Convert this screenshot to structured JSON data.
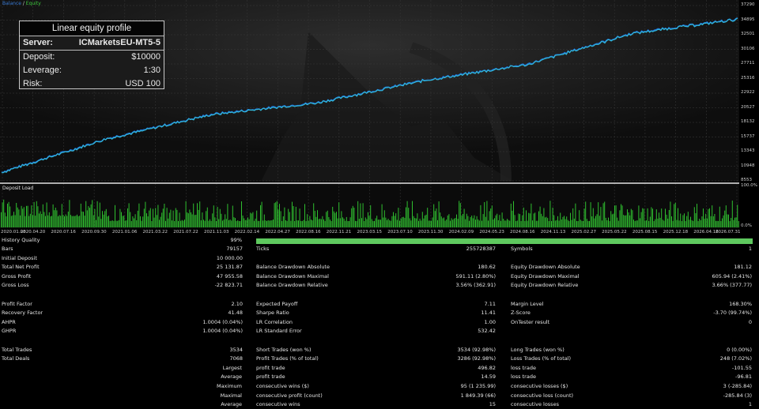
{
  "legend": {
    "balance": "Balance",
    "slash": " / ",
    "equity": "Equity"
  },
  "info_box": {
    "title": "Linear equity profile",
    "rows": [
      {
        "label": "Server:",
        "value": "ICMarketsEU-MT5-5"
      },
      {
        "label": "Deposit:",
        "value": "$10000"
      },
      {
        "label": "Leverage:",
        "value": "1:30"
      },
      {
        "label": "Risk:",
        "value": "USD 100"
      }
    ]
  },
  "deposit_load_label": "Deposit Load",
  "deposit_load_axis": [
    "100.0%",
    "0.0%"
  ],
  "colors": {
    "balance_line": "#1e6fd9",
    "equity_line": "#31b8d8",
    "deposit_load": "#2fbf2f",
    "history_bar": "#5ec85e"
  },
  "chart_data": {
    "type": "line",
    "series": [
      {
        "name": "Balance"
      },
      {
        "name": "Equity"
      }
    ],
    "ylim": [
      8553,
      37290
    ],
    "y_ticks": [
      "37290",
      "34895",
      "32501",
      "30106",
      "27711",
      "25316",
      "22922",
      "20527",
      "18132",
      "15737",
      "13343",
      "10948",
      "8553"
    ],
    "x_ticks": [
      "2020.01.08",
      "2020.04.20",
      "2020.07.16",
      "2020.09.30",
      "2021.01.06",
      "2021.03.22",
      "2021.07.22",
      "2021.11.03",
      "2022.02.14",
      "2022.04.27",
      "2022.08.16",
      "2022.11.21",
      "2023.03.15",
      "2023.07.10",
      "2023.11.30",
      "2024.02.09",
      "2024.05.23",
      "2024.08.16",
      "2024.11.13",
      "2025.02.27",
      "2025.05.22",
      "2025.08.15",
      "2025.12.18",
      "2026.04.16",
      "2026.07.31"
    ],
    "x": [
      "2020.01.08",
      "2021.01.06",
      "2022.02.14",
      "2023.03.15",
      "2024.02.09",
      "2025.02.27",
      "2026.04.16",
      "2026.07.31"
    ],
    "values": [
      10000,
      15500,
      19500,
      21400,
      25000,
      27700,
      32800,
      35100
    ],
    "grid": true,
    "legend": "top-left"
  },
  "report": {
    "history_quality": {
      "label": "History Quality",
      "value": "99%"
    },
    "rows": [
      {
        "c1": [
          "Bars",
          "79157"
        ],
        "c2": [
          "Ticks",
          "255728387"
        ],
        "c3": [
          "Symbols",
          "1"
        ]
      },
      {
        "c1": [
          "Initial Deposit",
          "10 000.00"
        ],
        "c2": [
          "",
          ""
        ],
        "c3": [
          "",
          ""
        ]
      },
      {
        "c1": [
          "Total Net Profit",
          "25 131.87"
        ],
        "c2": [
          "Balance Drawdown Absolute",
          "180.62"
        ],
        "c3": [
          "Equity Drawdown Absolute",
          "181.12"
        ]
      },
      {
        "c1": [
          "Gross Profit",
          "47 955.58"
        ],
        "c2": [
          "Balance Drawdown Maximal",
          "591.11 (2.80%)"
        ],
        "c3": [
          "Equity Drawdown Maximal",
          "605.94 (2.41%)"
        ]
      },
      {
        "c1": [
          "Gross Loss",
          "-22 823.71"
        ],
        "c2": [
          "Balance Drawdown Relative",
          "3.56% (362.91)"
        ],
        "c3": [
          "Equity Drawdown Relative",
          "3.66% (377.77)"
        ]
      },
      {
        "c1": [
          "",
          ""
        ],
        "c2": [
          "",
          ""
        ],
        "c3": [
          "",
          ""
        ]
      },
      {
        "c1": [
          "Profit Factor",
          "2.10"
        ],
        "c2": [
          "Expected Payoff",
          "7.11"
        ],
        "c3": [
          "Margin Level",
          "168.30%"
        ]
      },
      {
        "c1": [
          "Recovery Factor",
          "41.48"
        ],
        "c2": [
          "Sharpe Ratio",
          "11.41"
        ],
        "c3": [
          "Z-Score",
          "-3.70 (99.74%)"
        ]
      },
      {
        "c1": [
          "AHPR",
          "1.0004 (0.04%)"
        ],
        "c2": [
          "LR Correlation",
          "1.00"
        ],
        "c3": [
          "OnTester result",
          "0"
        ]
      },
      {
        "c1": [
          "GHPR",
          "1.0004 (0.04%)"
        ],
        "c2": [
          "LR Standard Error",
          "532.42"
        ],
        "c3": [
          "",
          ""
        ]
      },
      {
        "c1": [
          "",
          ""
        ],
        "c2": [
          "",
          ""
        ],
        "c3": [
          "",
          ""
        ]
      },
      {
        "c1": [
          "Total Trades",
          "3534"
        ],
        "c2": [
          "Short Trades (won %)",
          "3534 (92.98%)"
        ],
        "c3": [
          "Long Trades (won %)",
          "0 (0.00%)"
        ]
      },
      {
        "c1": [
          "Total Deals",
          "7068"
        ],
        "c2": [
          "Profit Trades (% of total)",
          "3286 (92.98%)"
        ],
        "c3": [
          "Loss Trades (% of total)",
          "248 (7.02%)"
        ]
      },
      {
        "c1": [
          "Largest",
          ""
        ],
        "c2": [
          "profit trade",
          "496.82"
        ],
        "c3": [
          "loss trade",
          "-101.55"
        ],
        "indent": true
      },
      {
        "c1": [
          "Average",
          ""
        ],
        "c2": [
          "profit trade",
          "14.59"
        ],
        "c3": [
          "loss trade",
          "-96.81"
        ],
        "indent": true
      },
      {
        "c1": [
          "Maximum",
          ""
        ],
        "c2": [
          "consecutive wins ($)",
          "95 (1 235.99)"
        ],
        "c3": [
          "consecutive losses ($)",
          "3 (-285.84)"
        ],
        "indent": true
      },
      {
        "c1": [
          "Maximal",
          ""
        ],
        "c2": [
          "consecutive profit (count)",
          "1 849.39 (66)"
        ],
        "c3": [
          "consecutive loss (count)",
          "-285.84 (3)"
        ],
        "indent": true
      },
      {
        "c1": [
          "Average",
          ""
        ],
        "c2": [
          "consecutive wins",
          "15"
        ],
        "c3": [
          "consecutive losses",
          "1"
        ],
        "indent": true
      }
    ]
  }
}
